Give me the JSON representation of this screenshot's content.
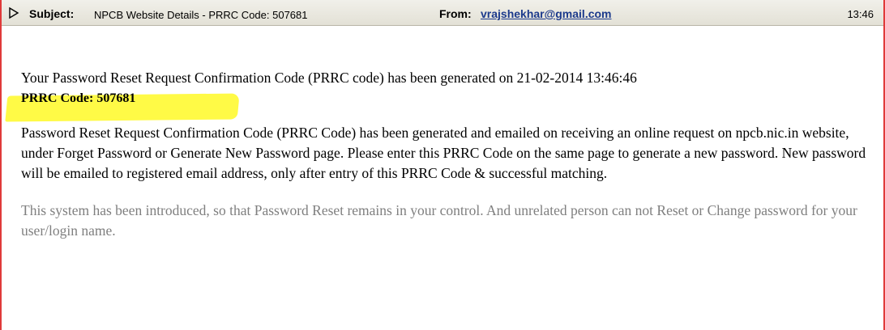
{
  "header": {
    "expand_icon": "triangle-right-icon",
    "subject_label": "Subject:",
    "subject_value": "NPCB Website Details - PRRC Code: 507681",
    "from_label": "From:",
    "from_value": "vrajshekhar@gmail.com",
    "time": "13:46"
  },
  "message": {
    "line1": "Your Password Reset Request Confirmation Code (PRRC code) has been generated on 21-02-2014 13:46:46",
    "code_line": "PRRC Code: 507681",
    "paragraph1": "Password Reset Request Confirmation Code (PRRC Code) has been generated and emailed on receiving an online request on npcb.nic.in website, under Forget Password or Generate New Password page. Please enter this PRRC Code on the same page to generate a new password. New password will be emailed to registered email address, only after entry of this PRRC Code & successful matching.",
    "paragraph2": "This system has been introduced, so that Password Reset remains in your control. And unrelated person can not Reset or Change password for your user/login name."
  },
  "colors": {
    "frame_border": "#e03a3a",
    "highlight": "#fffa3c",
    "link": "#1c3a8c",
    "muted_text": "#7f7f7f"
  }
}
